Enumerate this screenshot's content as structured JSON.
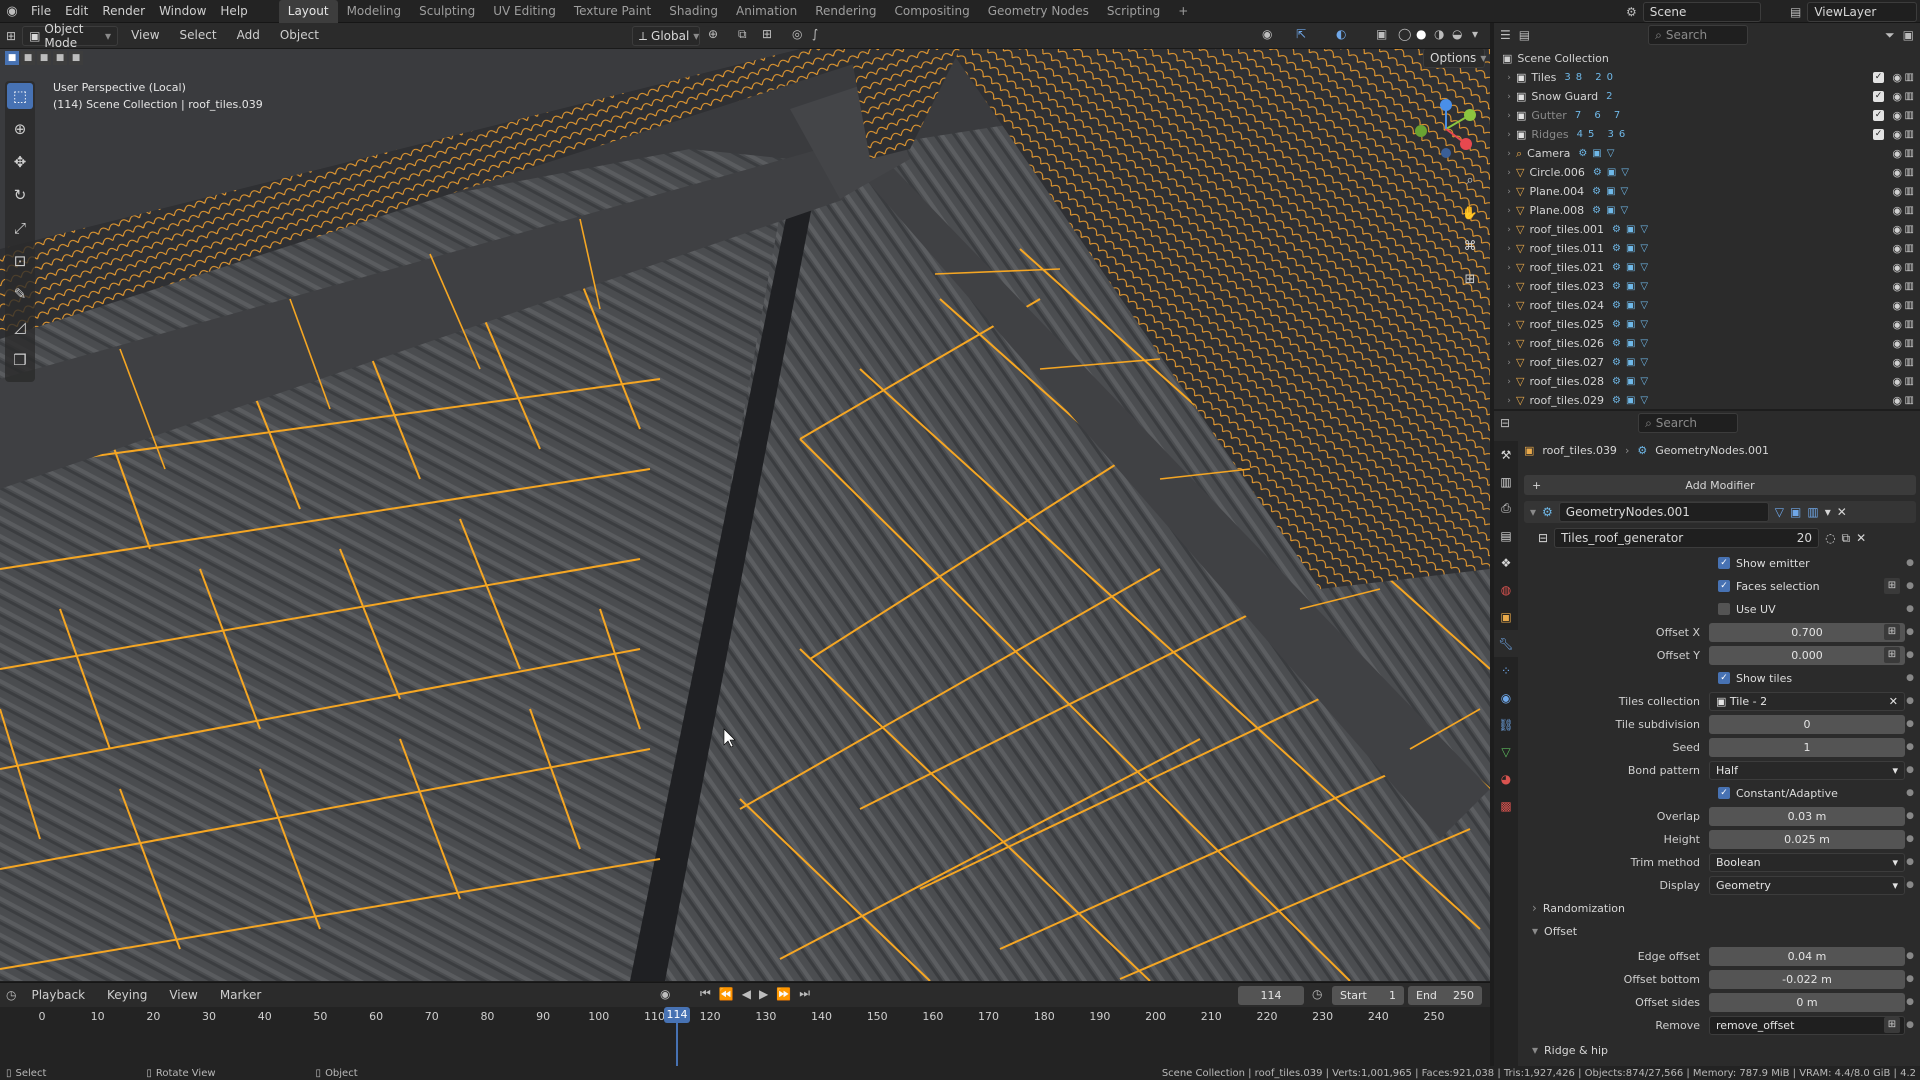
{
  "menus": [
    "File",
    "Edit",
    "Render",
    "Window",
    "Help"
  ],
  "workspaces": [
    "Layout",
    "Modeling",
    "Sculpting",
    "UV Editing",
    "Texture Paint",
    "Shading",
    "Animation",
    "Rendering",
    "Compositing",
    "Geometry Nodes",
    "Scripting"
  ],
  "scene": {
    "name": "Scene",
    "view_layer": "ViewLayer"
  },
  "viewport": {
    "mode": "Object Mode",
    "menus": [
      "View",
      "Select",
      "Add",
      "Object"
    ],
    "orientation": "Global",
    "options_label": "Options",
    "info_line1": "User Perspective (Local)",
    "info_line2": "(114) Scene Collection | roof_tiles.039",
    "gizmo_axes": [
      "X",
      "Y",
      "Z"
    ]
  },
  "outliner": {
    "search_placeholder": "Search",
    "root": "Scene Collection",
    "items": [
      {
        "name": "Tiles",
        "type": "collection",
        "badge": "38  20",
        "checked": true
      },
      {
        "name": "Snow Guard",
        "type": "collection",
        "badge": "2",
        "checked": true
      },
      {
        "name": "Gutter",
        "type": "collection",
        "badge": "7  6  7",
        "checked": true,
        "dim": true
      },
      {
        "name": "Ridges",
        "type": "collection",
        "badge": "45  36",
        "checked": true,
        "dim": true
      },
      {
        "name": "Camera",
        "type": "camera",
        "badge": "",
        "checked": false
      },
      {
        "name": "Circle.006",
        "type": "mesh",
        "badge": "",
        "checked": false
      },
      {
        "name": "Plane.004",
        "type": "mesh",
        "badge": "",
        "checked": false
      },
      {
        "name": "Plane.008",
        "type": "mesh",
        "badge": "",
        "checked": false
      },
      {
        "name": "roof_tiles.001",
        "type": "mesh",
        "badge": "",
        "checked": false
      },
      {
        "name": "roof_tiles.011",
        "type": "mesh",
        "badge": "",
        "checked": false
      },
      {
        "name": "roof_tiles.021",
        "type": "mesh",
        "badge": "",
        "checked": false
      },
      {
        "name": "roof_tiles.023",
        "type": "mesh",
        "badge": "",
        "checked": false
      },
      {
        "name": "roof_tiles.024",
        "type": "mesh",
        "badge": "",
        "checked": false
      },
      {
        "name": "roof_tiles.025",
        "type": "mesh",
        "badge": "",
        "checked": false
      },
      {
        "name": "roof_tiles.026",
        "type": "mesh",
        "badge": "",
        "checked": false
      },
      {
        "name": "roof_tiles.027",
        "type": "mesh",
        "badge": "",
        "checked": false
      },
      {
        "name": "roof_tiles.028",
        "type": "mesh",
        "badge": "",
        "checked": false
      },
      {
        "name": "roof_tiles.029",
        "type": "mesh",
        "badge": "",
        "checked": false
      }
    ]
  },
  "properties": {
    "search_placeholder": "Search",
    "breadcrumb": [
      "roof_tiles.039",
      "GeometryNodes.001"
    ],
    "add_modifier": "Add Modifier",
    "modifier_name": "GeometryNodes.001",
    "node_group": "Tiles_roof_generator",
    "node_group_users": "20",
    "show_emitter": "Show emitter",
    "faces_selection": "Faces selection",
    "use_uv": "Use UV",
    "offset_x": {
      "label": "Offset X",
      "value": "0.700"
    },
    "offset_y": {
      "label": "Offset Y",
      "value": "0.000"
    },
    "show_tiles": "Show tiles",
    "tiles_collection": {
      "label": "Tiles collection",
      "value": "Tile - 2"
    },
    "tile_subdivision": {
      "label": "Tile subdivision",
      "value": "0"
    },
    "seed": {
      "label": "Seed",
      "value": "1"
    },
    "bond_pattern": {
      "label": "Bond pattern",
      "value": "Half"
    },
    "constant_adaptive": "Constant/Adaptive",
    "overlap": {
      "label": "Overlap",
      "value": "0.03 m"
    },
    "height": {
      "label": "Height",
      "value": "0.025 m"
    },
    "trim_method": {
      "label": "Trim method",
      "value": "Boolean"
    },
    "display": {
      "label": "Display",
      "value": "Geometry"
    },
    "randomization": "Randomization",
    "offset_panel": "Offset",
    "edge_offset": {
      "label": "Edge offset",
      "value": "0.04 m"
    },
    "offset_bottom": {
      "label": "Offset bottom",
      "value": "-0.022 m"
    },
    "offset_sides": {
      "label": "Offset sides",
      "value": "0 m"
    },
    "remove": {
      "label": "Remove",
      "value": "remove_offset"
    },
    "ridge_hip": "Ridge & hip"
  },
  "timeline": {
    "menus": [
      "Playback",
      "Keying",
      "View",
      "Marker"
    ],
    "current_frame": "114",
    "start_label": "Start",
    "start": "1",
    "end_label": "End",
    "end": "250",
    "ticks": [
      "0",
      "10",
      "20",
      "30",
      "40",
      "50",
      "60",
      "70",
      "80",
      "90",
      "100",
      "110",
      "120",
      "130",
      "140",
      "150",
      "160",
      "170",
      "180",
      "190",
      "200",
      "210",
      "220",
      "230",
      "240",
      "250"
    ]
  },
  "statusbar": {
    "select": "Select",
    "rotate": "Rotate View",
    "object": "Object",
    "stats": "Scene Collection | roof_tiles.039 | Verts:1,001,965 | Faces:921,038 | Tris:1,927,426 | Objects:874/27,566 | Memory: 787.9 MiB | VRAM: 4.4/8.0 GiB | 4.2"
  },
  "colors": {
    "accent": "#4772b3",
    "select_orange": "#f5a623",
    "tile": "#4d4f52",
    "panel": "#2b2b2b"
  }
}
